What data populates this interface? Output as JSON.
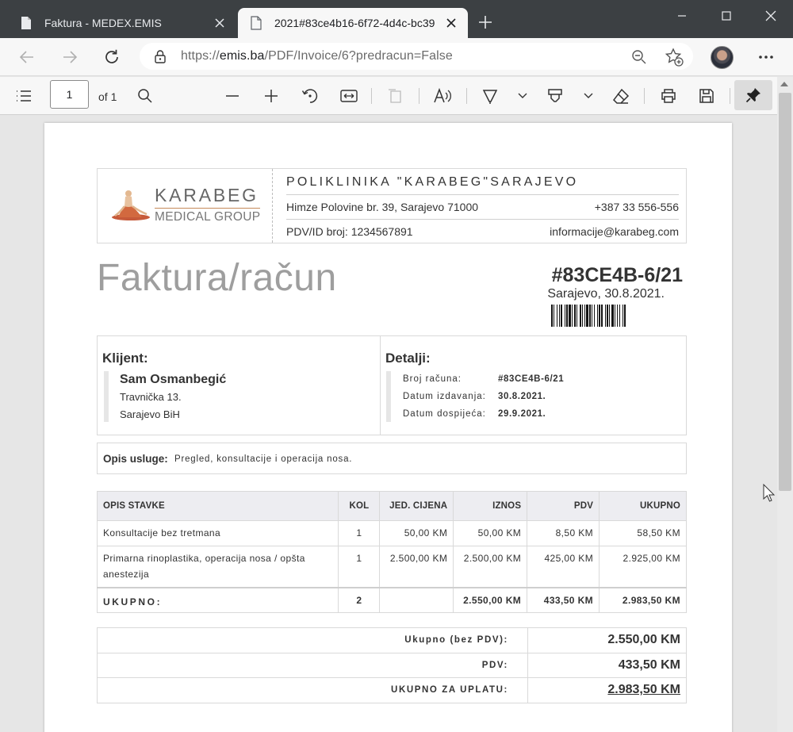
{
  "browser": {
    "tabs": [
      {
        "title": "Faktura - MEDEX.EMIS",
        "active": false
      },
      {
        "title": "2021#83ce4b16-6f72-4d4c-bc39",
        "active": true
      }
    ],
    "url_prefix": "https://",
    "url_domain": "emis.ba",
    "url_path": "/PDF/Invoice/6?predracun=False"
  },
  "pdf_toolbar": {
    "page_current": "1",
    "page_of": "of 1"
  },
  "invoice": {
    "logo_name": "KARABEG",
    "logo_sub": "MEDICAL GROUP",
    "clinic": {
      "name": "POLIKLINIKA \"KARABEG\"SARAJEVO",
      "address": "Himze Polovine br. 39, Sarajevo 71000",
      "phone": "+387 33 556-556",
      "tax_id": "PDV/ID broj: 1234567891",
      "email": "informacije@karabeg.com"
    },
    "title": "Faktura/račun",
    "number": "#83CE4B-6/21",
    "place_date": "Sarajevo, 30.8.2021.",
    "client": {
      "heading": "Klijent:",
      "name": "Sam Osmanbegić",
      "street": "Travnička 13.",
      "city": "Sarajevo BiH"
    },
    "details": {
      "heading": "Detalji:",
      "rows": [
        {
          "label": "Broj računa:",
          "value": "#83CE4B-6/21"
        },
        {
          "label": "Datum izdavanja:",
          "value": "30.8.2021."
        },
        {
          "label": "Datum dospijeća:",
          "value": "29.9.2021."
        }
      ]
    },
    "service": {
      "label": "Opis usluge:",
      "text": "Pregled, konsultacije i operacija nosa."
    },
    "items": {
      "headers": [
        "OPIS STAVKE",
        "KOL",
        "JED. CIJENA",
        "IZNOS",
        "PDV",
        "UKUPNO"
      ],
      "rows": [
        [
          "Konsultacije bez tretmana",
          "1",
          "50,00 KM",
          "50,00 KM",
          "8,50 KM",
          "58,50 KM"
        ],
        [
          "Primarna rinoplastika, operacija nosa / opšta anestezija",
          "1",
          "2.500,00 KM",
          "2.500,00 KM",
          "425,00 KM",
          "2.925,00 KM"
        ]
      ],
      "total": [
        "UKUPNO:",
        "2",
        "",
        "2.550,00 KM",
        "433,50 KM",
        "2.983,50 KM"
      ]
    },
    "totals": [
      {
        "label": "Ukupno (bez PDV):",
        "value": "2.550,00 KM"
      },
      {
        "label": "PDV:",
        "value": "433,50 KM"
      },
      {
        "label": "UKUPNO ZA UPLATU:",
        "value": "2.983,50 KM"
      }
    ]
  }
}
